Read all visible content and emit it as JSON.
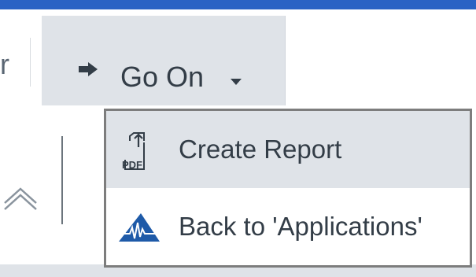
{
  "toolbar": {
    "partial_label": "r",
    "go_on_label": "Go On",
    "arrow_icon": "arrow-right-icon",
    "caret_icon": "caret-down-icon"
  },
  "menu": {
    "items": [
      {
        "label": "Create Report",
        "icon": "pdf-export-icon"
      },
      {
        "label": "Back to 'Applications'",
        "icon": "mountain-logo-icon"
      }
    ]
  },
  "colors": {
    "top_bar": "#2a62c4",
    "button_bg": "#dfe3e8",
    "text": "#333d47",
    "logo": "#1e5aa8"
  }
}
